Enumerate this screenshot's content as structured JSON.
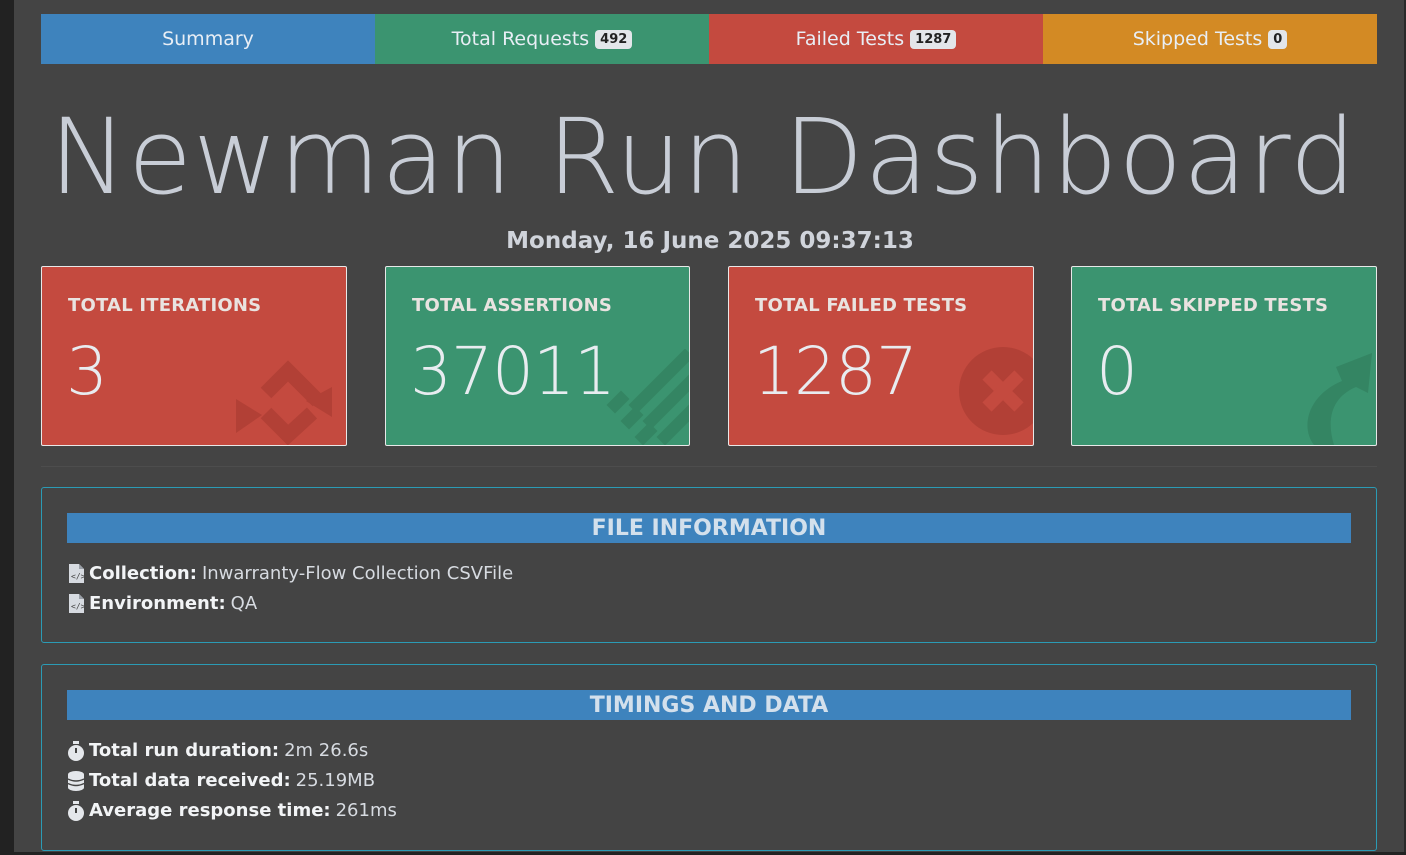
{
  "tabs": [
    {
      "label": "Summary",
      "badge": null
    },
    {
      "label": "Total Requests",
      "badge": "492"
    },
    {
      "label": "Failed Tests",
      "badge": "1287"
    },
    {
      "label": "Skipped Tests",
      "badge": "0"
    }
  ],
  "title": "Newman Run Dashboard",
  "timestamp": "Monday, 16 June 2025 09:37:13",
  "cards": [
    {
      "label": "TOTAL ITERATIONS",
      "value": "3",
      "icon": "sync-icon",
      "color": "#c44a3f"
    },
    {
      "label": "TOTAL ASSERTIONS",
      "value": "37011",
      "icon": "list-icon",
      "color": "#3b9470"
    },
    {
      "label": "TOTAL FAILED TESTS",
      "value": "1287",
      "icon": "times-circle-icon",
      "color": "#c44a3f"
    },
    {
      "label": "TOTAL SKIPPED TESTS",
      "value": "0",
      "icon": "share-arrow-icon",
      "color": "#3b9470"
    }
  ],
  "file_info": {
    "heading": "FILE INFORMATION",
    "collection_label": "Collection:",
    "collection_value": "Inwarranty-Flow Collection CSVFile",
    "environment_label": "Environment:",
    "environment_value": "QA"
  },
  "timings": {
    "heading": "TIMINGS AND DATA",
    "duration_label": "Total run duration:",
    "duration_value": "2m 26.6s",
    "data_label": "Total data received:",
    "data_value": "25.19MB",
    "response_label": "Average response time:",
    "response_value": "261ms"
  },
  "colors": {
    "blue": "#3e83bd",
    "green": "#3b9470",
    "red": "#c44a3f",
    "orange": "#d38a24",
    "background": "#444444"
  }
}
